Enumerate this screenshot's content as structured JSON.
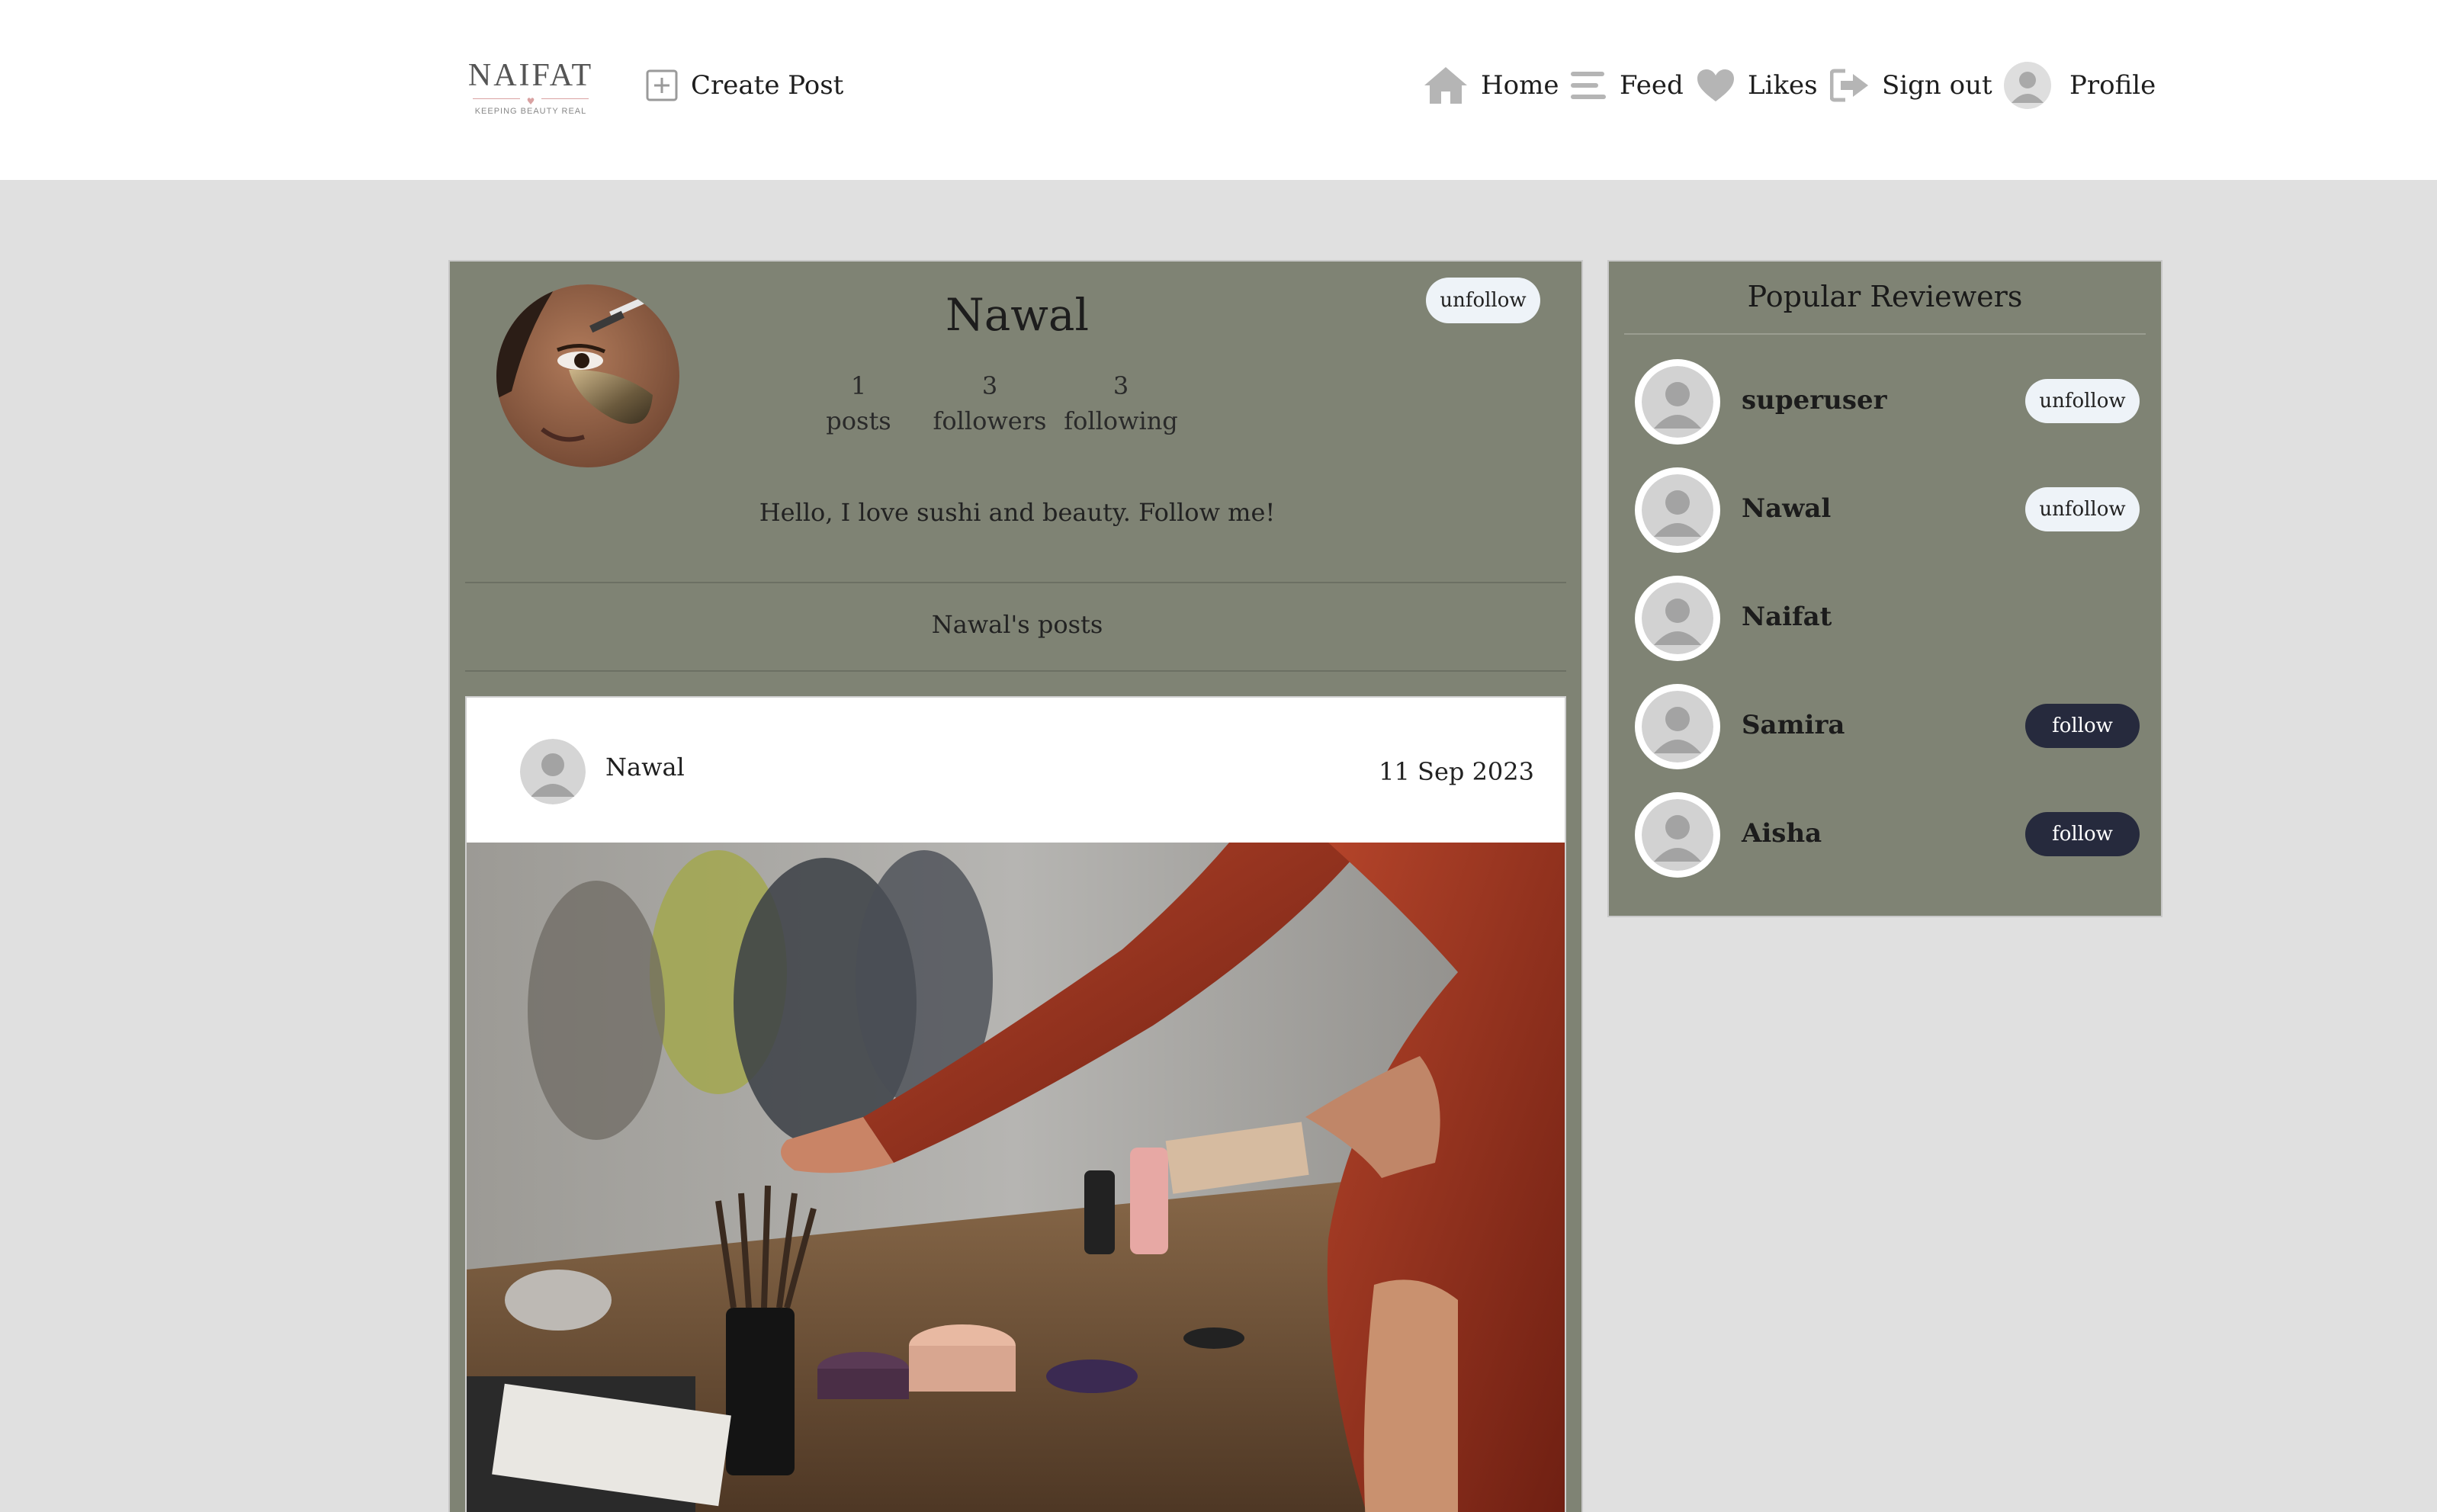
{
  "header": {
    "logo": {
      "name": "NAIFAT",
      "tagline": "KEEPING BEAUTY REAL"
    },
    "create_post": {
      "label": "Create Post",
      "icon": "plus-square-icon"
    },
    "nav": [
      {
        "label": "Home",
        "icon": "home-icon"
      },
      {
        "label": "Feed",
        "icon": "feed-icon"
      },
      {
        "label": "Likes",
        "icon": "heart-icon"
      },
      {
        "label": "Sign out",
        "icon": "sign-out-icon"
      },
      {
        "label": "Profile",
        "icon": "user-avatar-icon"
      }
    ]
  },
  "profile": {
    "name": "Nawal",
    "follow_button": "unfollow",
    "stats": [
      {
        "value": "1",
        "label": "posts"
      },
      {
        "value": "3",
        "label": "followers"
      },
      {
        "value": "3",
        "label": "following"
      }
    ],
    "bio": "Hello, I love sushi and beauty. Follow me!",
    "posts_title": "Nawal's posts"
  },
  "post": {
    "author": "Nawal",
    "date": "11 Sep 2023"
  },
  "reviewers": {
    "title": "Popular Reviewers",
    "items": [
      {
        "name": "superuser",
        "button": "unfollow",
        "state": "unfollow"
      },
      {
        "name": "Nawal",
        "button": "unfollow",
        "state": "unfollow"
      },
      {
        "name": "Naifat",
        "button": "",
        "state": "none"
      },
      {
        "name": "Samira",
        "button": "follow",
        "state": "follow"
      },
      {
        "name": "Aisha",
        "button": "follow",
        "state": "follow"
      }
    ]
  },
  "colors": {
    "card_bg": "#7f8374",
    "page_bg": "#e0e0e0",
    "follow_button": "#262a3d",
    "unfollow_button": "#eef3f8"
  }
}
